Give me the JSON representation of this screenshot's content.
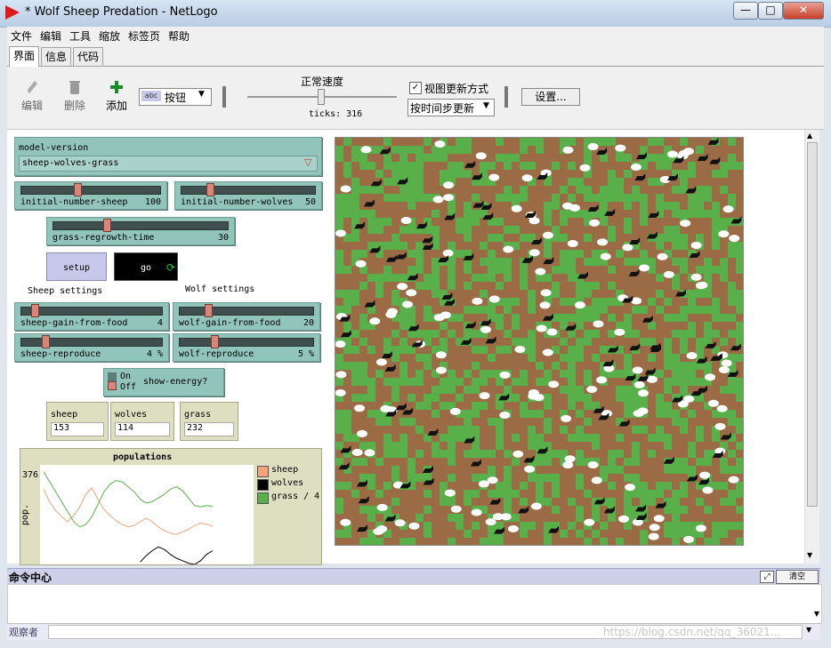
{
  "window": {
    "title": "* Wolf Sheep Predation - NetLogo",
    "minimize": "—",
    "maximize": "□",
    "close": "✕"
  },
  "menu": [
    "文件",
    "编辑",
    "工具",
    "缩放",
    "标签页",
    "帮助"
  ],
  "tabs": [
    "界面",
    "信息",
    "代码"
  ],
  "toolbar": {
    "edit": "编辑",
    "delete": "删除",
    "add": "添加",
    "widget_type": "按钮",
    "speed_label": "正常速度",
    "ticks": "ticks: 316",
    "view_updates_label": "视图更新方式",
    "view_updates_checked": true,
    "update_mode": "按时间步更新",
    "settings": "设置..."
  },
  "chooser": {
    "label": "model-version",
    "value": "sheep-wolves-grass"
  },
  "sliders": [
    {
      "name": "initial-number-sheep",
      "value": "100",
      "pos": 0.4
    },
    {
      "name": "initial-number-wolves",
      "value": "50",
      "pos": 0.2
    },
    {
      "name": "grass-regrowth-time",
      "value": "30",
      "pos": 0.3
    },
    {
      "name": "sheep-gain-from-food",
      "value": "4",
      "pos": 0.08
    },
    {
      "name": "wolf-gain-from-food",
      "value": "20",
      "pos": 0.2
    },
    {
      "name": "sheep-reproduce",
      "value": "4 %",
      "pos": 0.16
    },
    {
      "name": "wolf-reproduce",
      "value": "5 %",
      "pos": 0.25
    }
  ],
  "buttons": {
    "setup": "setup",
    "go": "go"
  },
  "section_labels": {
    "sheep": "Sheep settings",
    "wolf": "Wolf settings"
  },
  "switch": {
    "on": "On",
    "off": "Off",
    "label": "show-energy?"
  },
  "monitors": [
    {
      "label": "sheep",
      "value": "153"
    },
    {
      "label": "wolves",
      "value": "114"
    },
    {
      "label": "grass",
      "value": "232"
    }
  ],
  "plot": {
    "title": "populations",
    "y_max_label": "376",
    "ylabel": "pop.",
    "legend": [
      {
        "name": "sheep",
        "color": "#f4a37a"
      },
      {
        "name": "wolves",
        "color": "#000000"
      },
      {
        "name": "grass / 4",
        "color": "#59b04a"
      }
    ]
  },
  "chart_data": {
    "type": "line",
    "title": "populations",
    "ylabel": "pop.",
    "ylim": [
      0,
      376
    ],
    "series": [
      {
        "name": "sheep",
        "values": [
          300,
          250,
          215,
          190,
          170,
          195,
          230,
          280,
          305,
          260,
          220,
          195,
          175,
          160,
          150,
          155,
          170,
          185,
          170,
          150,
          135,
          125,
          120,
          130,
          140,
          155,
          165,
          160,
          153
        ]
      },
      {
        "name": "wolves",
        "values": [
          null,
          null,
          null,
          null,
          null,
          null,
          null,
          null,
          null,
          null,
          null,
          null,
          null,
          null,
          null,
          null,
          10,
          35,
          55,
          70,
          60,
          40,
          25,
          15,
          5,
          0,
          15,
          40,
          55
        ]
      },
      {
        "name": "grass / 4",
        "values": [
          370,
          330,
          290,
          250,
          210,
          170,
          150,
          160,
          190,
          240,
          290,
          320,
          335,
          330,
          310,
          290,
          260,
          245,
          250,
          265,
          280,
          300,
          310,
          295,
          265,
          235,
          230,
          235,
          232
        ]
      }
    ]
  },
  "command_center": {
    "title": "命令中心",
    "clear": "清空",
    "observer": "观察者"
  },
  "colors": {
    "grass": "#59b04a",
    "dirt": "#9b6b45",
    "sheep": "#ffffff",
    "wolf": "#111111"
  },
  "watermark": "https://blog.csdn.net/qq_36021..."
}
